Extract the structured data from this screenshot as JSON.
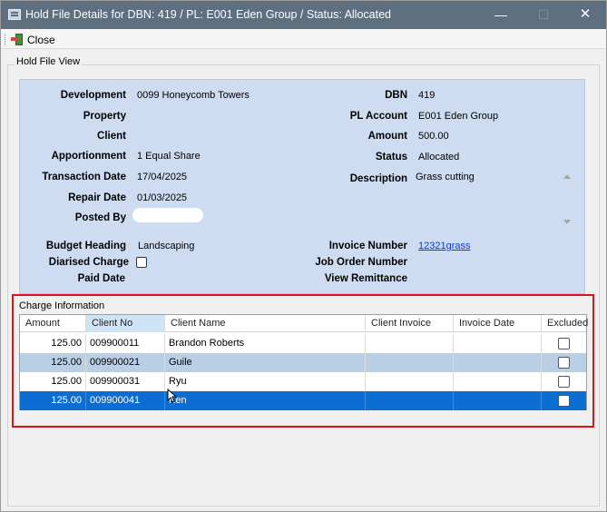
{
  "window": {
    "title": "Hold File Details for DBN: 419   /   PL: E001   Eden Group   /   Status: Allocated",
    "min_glyph": "—",
    "max_glyph": "☐",
    "close_glyph": "✕"
  },
  "toolbar": {
    "close_label": "Close"
  },
  "group_label": "Hold File View",
  "fields_left": {
    "development_label": "Development",
    "development_value": "0099   Honeycomb Towers",
    "property_label": "Property",
    "client_label": "Client",
    "apportionment_label": "Apportionment",
    "apportionment_value": "1   Equal Share",
    "transaction_date_label": "Transaction Date",
    "transaction_date_value": "17/04/2025",
    "repair_date_label": "Repair Date",
    "repair_date_value": "01/03/2025",
    "posted_by_label": "Posted By",
    "budget_heading_label": "Budget Heading",
    "budget_heading_value": "Landscaping",
    "diarised_charge_label": "Diarised Charge",
    "paid_date_label": "Paid Date"
  },
  "fields_right": {
    "dbn_label": "DBN",
    "dbn_value": "419",
    "pl_account_label": "PL Account",
    "pl_account_value": "E001   Eden Group",
    "amount_label": "Amount",
    "amount_value": "500.00",
    "status_label": "Status",
    "status_value": "Allocated",
    "description_label": "Description",
    "description_value": "Grass cutting",
    "invoice_number_label": "Invoice Number",
    "invoice_number_value": "12321grass",
    "job_order_number_label": "Job Order Number",
    "view_remittance_label": "View Remittance"
  },
  "charge_info": {
    "title": "Charge Information",
    "columns": [
      "Amount",
      "Client No",
      "Client Name",
      "Client Invoice",
      "Invoice Date",
      "Excluded"
    ],
    "rows": [
      {
        "amount": "125.00",
        "client_no": "009900011",
        "client_name": "Brandon Roberts",
        "client_invoice": "",
        "invoice_date": "",
        "excluded": false
      },
      {
        "amount": "125.00",
        "client_no": "009900021",
        "client_name": "Guile",
        "client_invoice": "",
        "invoice_date": "",
        "excluded": false
      },
      {
        "amount": "125.00",
        "client_no": "009900031",
        "client_name": "Ryu",
        "client_invoice": "",
        "invoice_date": "",
        "excluded": false
      },
      {
        "amount": "125.00",
        "client_no": "009900041",
        "client_name": "Ken",
        "client_invoice": "",
        "invoice_date": "",
        "excluded": false
      }
    ]
  },
  "colors": {
    "titlebar": "#5e6f80",
    "panel": "#cddcf0",
    "row_alt": "#b9cfe6",
    "row_selected": "#0c6dd3",
    "highlight_box": "#e0111b",
    "link": "#0a3ad8"
  }
}
